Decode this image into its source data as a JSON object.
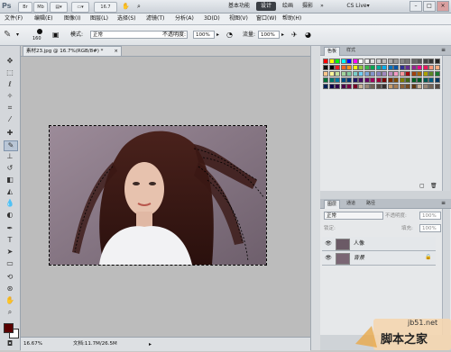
{
  "titlebar": {
    "logo": "Ps",
    "buttons": [
      "Br",
      "Mb",
      "▤▾",
      "▭▾"
    ],
    "zoom": "16.7",
    "workspaces": [
      "基本功能",
      "设计",
      "绘画",
      "摄影"
    ],
    "workspace_more": "»",
    "cs_live": "CS Live▾",
    "win_controls": [
      "–",
      "□",
      "×"
    ]
  },
  "menubar": {
    "items": [
      "文件(F)",
      "编辑(E)",
      "图像(I)",
      "图层(L)",
      "选择(S)",
      "滤镜(T)",
      "分析(A)",
      "3D(D)",
      "视图(V)",
      "窗口(W)",
      "帮助(H)"
    ]
  },
  "options": {
    "brush_size": "160",
    "mode_label": "模式:",
    "mode_value": "正常",
    "opacity_label": "不透明度:",
    "opacity_value": "100%",
    "flow_label": "流量:",
    "flow_value": "100%"
  },
  "document": {
    "tab_title": "素材23.jpg @ 16.7%(RGB/8#) *",
    "tab_close": "×",
    "zoom": "16.67%",
    "doc_info": "文档:11.7M/26.5M"
  },
  "swatches_panel": {
    "tabs": [
      "色板",
      "样式"
    ],
    "colors": [
      "#ff0000",
      "#ffff00",
      "#00ff00",
      "#00ffff",
      "#0000ff",
      "#ff00ff",
      "#ffffff",
      "#eeeeee",
      "#dddddd",
      "#cccccc",
      "#bbbbbb",
      "#aaaaaa",
      "#999999",
      "#888888",
      "#777777",
      "#666666",
      "#555555",
      "#444444",
      "#333333",
      "#222222",
      "#111111",
      "#000000",
      "#ed1c24",
      "#f26522",
      "#f7941d",
      "#fff200",
      "#8dc63f",
      "#39b54a",
      "#00a651",
      "#00a99d",
      "#00aeef",
      "#0072bc",
      "#0054a6",
      "#2e3192",
      "#662d91",
      "#92278f",
      "#ec008c",
      "#ed145b",
      "#f7977a",
      "#f9ad81",
      "#fdc68a",
      "#fff79a",
      "#c4df9b",
      "#a3d39c",
      "#82ca9d",
      "#7accc8",
      "#6dcff6",
      "#7da7d9",
      "#8393ca",
      "#8781bd",
      "#a187be",
      "#bd8cbf",
      "#f49ac2",
      "#f6989d",
      "#9e0b0f",
      "#a0410d",
      "#a36209",
      "#aba000",
      "#598527",
      "#1a7b30",
      "#007236",
      "#00746b",
      "#0076a3",
      "#004a80",
      "#003471",
      "#1b1464",
      "#440e62",
      "#630460",
      "#9e005d",
      "#9e0039",
      "#790000",
      "#7b2e00",
      "#7d4900",
      "#827b00",
      "#406618",
      "#005e20",
      "#005826",
      "#005952",
      "#005b7f",
      "#003663",
      "#002157",
      "#0d004c",
      "#32004b",
      "#4b0049",
      "#7b0046",
      "#7a0026",
      "#c7b299",
      "#998675",
      "#736357",
      "#534741",
      "#362f2d",
      "#c69c6d",
      "#a67c52",
      "#8c6239",
      "#754c24",
      "#603913",
      "#c7b299",
      "#998675",
      "#736357",
      "#534741"
    ]
  },
  "layers_panel": {
    "tabs": [
      "图层",
      "通道",
      "路径"
    ],
    "blend_mode": "正常",
    "opacity_label": "不透明度:",
    "opacity_value": "100%",
    "lock_label": "锁定:",
    "fill_label": "填充:",
    "fill_value": "100%",
    "layers": [
      {
        "name": "人像",
        "visible": true
      },
      {
        "name": "背景",
        "visible": true,
        "locked": true
      }
    ]
  },
  "watermark": {
    "line1": "jb51.net",
    "line2": "脚本之家"
  },
  "colors": {
    "foreground": "#5a0000",
    "background": "#ffffff",
    "active_workspace": "#3b3f45"
  }
}
